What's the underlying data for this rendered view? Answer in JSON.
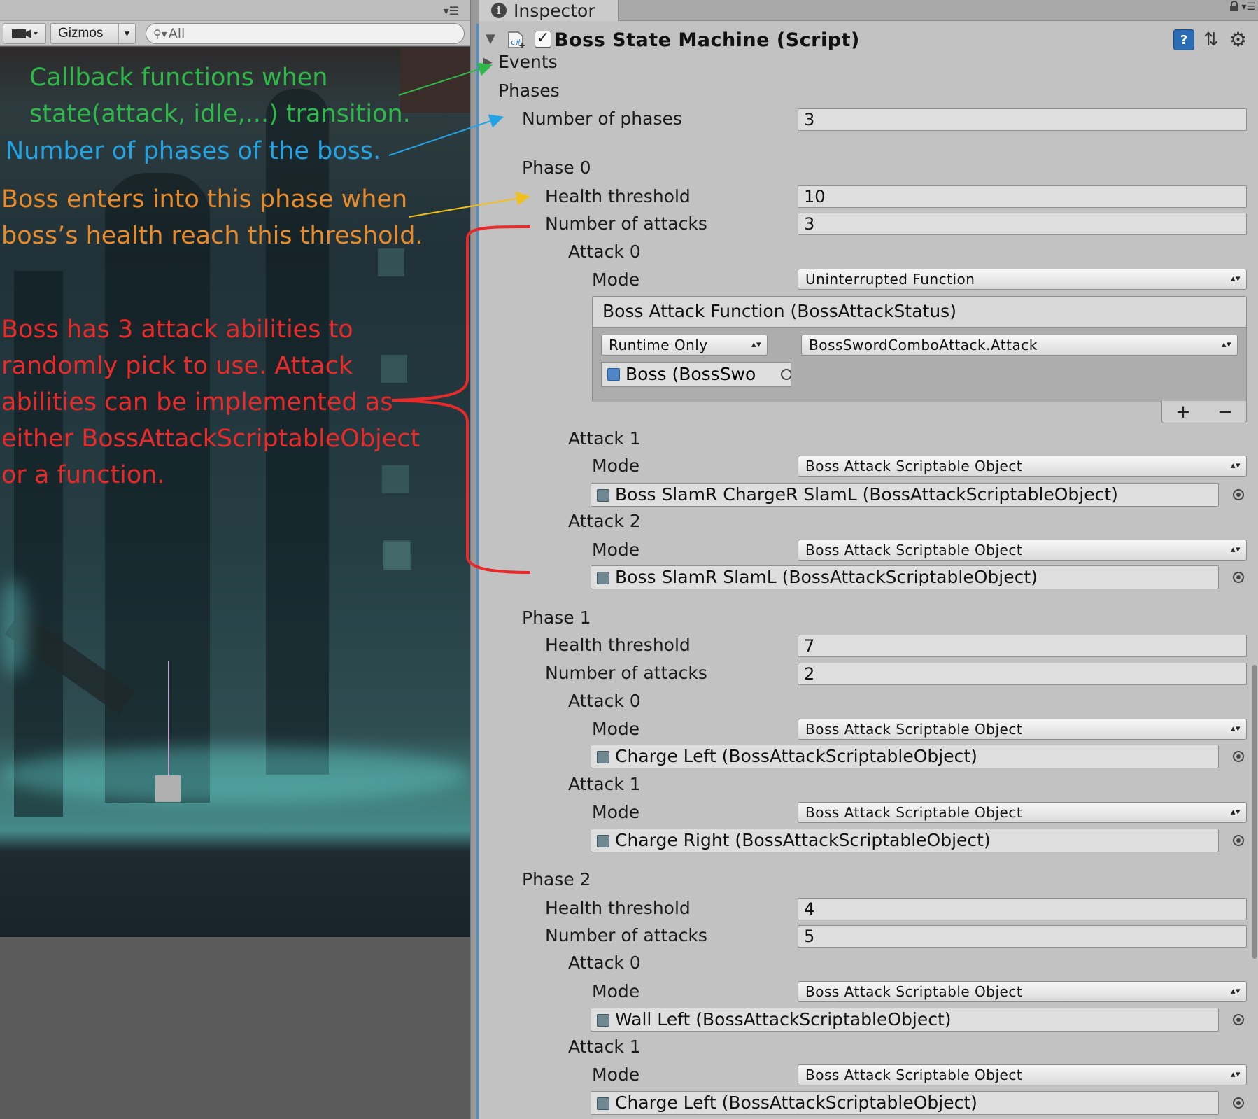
{
  "scene": {
    "toolbar": {
      "camera_icon": "camera-icon",
      "gizmos_label": "Gizmos",
      "search_value": "All",
      "menu_icon": "menu-icon"
    },
    "annotations": {
      "events": [
        "Callback functions when",
        "state(attack, idle,...) transition."
      ],
      "phases": "Number of phases of the boss.",
      "threshold": [
        "Boss enters into this phase when",
        "boss’s health reach this threshold."
      ],
      "attacks": [
        "Boss has 3 attack abilities to",
        "randomly pick to use. Attack",
        "abilities can be implemented as",
        "either BossAttackScriptableObject",
        "or a function."
      ]
    },
    "annotation_colors": {
      "events": "#2fb84a",
      "phases": "#21a3e6",
      "threshold": "#e88b2c",
      "attacks": "#e82a2a"
    }
  },
  "inspector": {
    "tab_label": "Inspector",
    "component_title": "Boss State Machine (Script)",
    "component_enabled": true,
    "events_label": "Events",
    "phases_label": "Phases",
    "number_of_phases_label": "Number of phases",
    "number_of_phases_value": "3",
    "labels": {
      "health_threshold": "Health threshold",
      "number_of_attacks": "Number of attacks",
      "mode": "Mode"
    },
    "phase0": {
      "title": "Phase 0",
      "health_threshold": "10",
      "number_of_attacks": "3",
      "attack0": {
        "title": "Attack 0",
        "mode": "Uninterrupted Function",
        "event_title": "Boss Attack Function (BossAttackStatus)",
        "runtime": "Runtime Only",
        "method": "BossSwordComboAttack.Attack",
        "target": "Boss (BossSwo"
      },
      "attack1": {
        "title": "Attack 1",
        "mode": "Boss Attack Scriptable Object",
        "object": "Boss SlamR ChargeR SlamL (BossAttackScriptableObject)"
      },
      "attack2": {
        "title": "Attack 2",
        "mode": "Boss Attack Scriptable Object",
        "object": "Boss SlamR SlamL (BossAttackScriptableObject)"
      }
    },
    "phase1": {
      "title": "Phase 1",
      "health_threshold": "7",
      "number_of_attacks": "2",
      "attack0": {
        "title": "Attack 0",
        "mode": "Boss Attack Scriptable Object",
        "object": "Charge Left (BossAttackScriptableObject)"
      },
      "attack1": {
        "title": "Attack 1",
        "mode": "Boss Attack Scriptable Object",
        "object": "Charge Right (BossAttackScriptableObject)"
      }
    },
    "phase2": {
      "title": "Phase 2",
      "health_threshold": "4",
      "number_of_attacks": "5",
      "attack0": {
        "title": "Attack 0",
        "mode": "Boss Attack Scriptable Object",
        "object": "Wall Left (BossAttackScriptableObject)"
      },
      "attack1": {
        "title": "Attack 1",
        "mode": "Boss Attack Scriptable Object",
        "object": "Charge Left (BossAttackScriptableObject)"
      }
    },
    "list_add": "+",
    "list_remove": "−"
  }
}
